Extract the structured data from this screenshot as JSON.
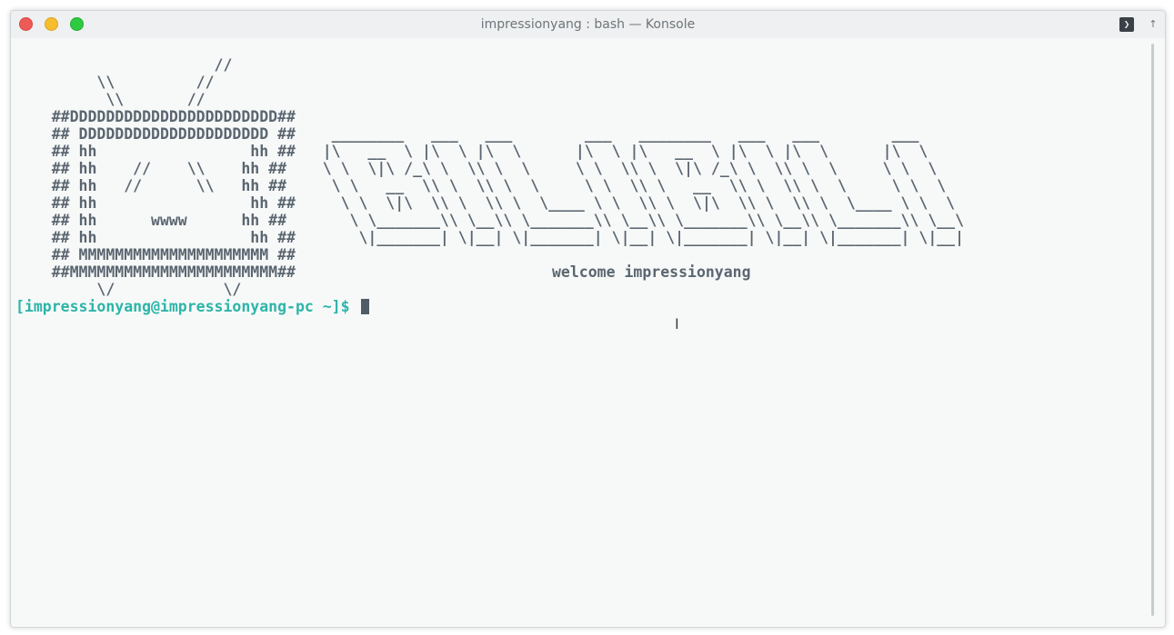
{
  "window": {
    "title": "impressionyang : bash — Konsole",
    "controls": {
      "close": "close-button",
      "minimize": "minimize-button",
      "maximize": "maximize-button"
    },
    "terminal_button_glyph": "❯",
    "pin_glyph": "↑"
  },
  "terminal": {
    "art_left": "                      //\n         \\\\         //\n          \\\\       //\n    ##DDDDDDDDDDDDDDDDDDDDDDD##\n    ## DDDDDDDDDDDDDDDDDDDDD ##\n    ## hh                 hh ##\n    ## hh    //    \\\\    hh ##\n    ## hh   //      \\\\   hh ##\n    ## hh                 hh ##\n    ## hh      wwww      hh ##\n    ## hh                 hh ##\n    ## MMMMMMMMMMMMMMMMMMMMM ##\n    ##MMMMMMMMMMMMMMMMMMMMMMM##\n         \\/            \\/",
    "art_right": "\n\n\n\n                                   ________   ___   ___        ___   ________   ___   ___        ___\n                                  |\\   __  \\ |\\  \\ |\\  \\      |\\  \\ |\\   __  \\ |\\  \\ |\\  \\      |\\  \\\n                                  \\ \\  \\|\\ /_\\ \\  \\\\ \\  \\     \\ \\  \\\\ \\  \\|\\ /_\\ \\  \\\\ \\  \\     \\ \\  \\\n                                   \\ \\   __  \\\\ \\  \\\\ \\  \\     \\ \\  \\\\ \\   __  \\\\ \\  \\\\ \\  \\     \\ \\  \\\n                                    \\ \\  \\|\\  \\\\ \\  \\\\ \\  \\____ \\ \\  \\\\ \\  \\|\\  \\\\ \\  \\\\ \\  \\____ \\ \\  \\\n                                     \\ \\_______\\\\ \\__\\\\ \\_______\\\\ \\__\\\\ \\_______\\\\ \\__\\\\ \\_______\\\\ \\__\\\n                                      \\|_______| \\|__| \\|_______| \\|__| \\|_______| \\|__| \\|_______| \\|__|",
    "welcome": "welcome impressionyang",
    "prompt": "[impressionyang@impressionyang-pc ~]$",
    "input": ""
  },
  "colors": {
    "background": "#f7f9f9",
    "text": "#5b6670",
    "prompt": "#2db5a8",
    "close": "#ee5a57",
    "minimize": "#f6bd2f",
    "maximize": "#2ecb41"
  }
}
